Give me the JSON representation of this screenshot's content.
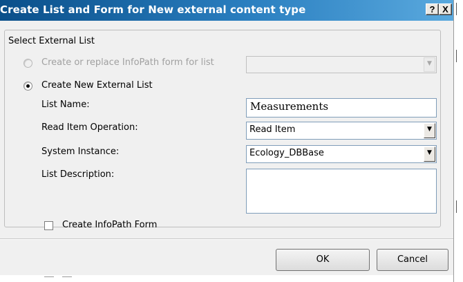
{
  "window": {
    "title": "Create List and Form for New external content type",
    "help_button": "?",
    "close_button": "X"
  },
  "group": {
    "legend": "Select External List"
  },
  "options": {
    "infopath_replace": {
      "label": "Create or replace InfoPath form for list",
      "selected": false,
      "enabled": false,
      "list_value": ""
    },
    "new_list": {
      "label": "Create New External List",
      "selected": true
    }
  },
  "fields": {
    "list_name": {
      "label": "List Name:",
      "value": "Measurements"
    },
    "read_item_operation": {
      "label": "Read Item Operation:",
      "value": "Read Item"
    },
    "system_instance": {
      "label": "System Instance:",
      "value": "Ecology_DBBase"
    },
    "list_description": {
      "label": "List Description:",
      "value": ""
    }
  },
  "create_infopath_form": {
    "label": "Create InfoPath Form",
    "checked": false
  },
  "buttons": {
    "ok": "OK",
    "cancel": "Cancel"
  },
  "icons": {
    "dropdown": "chevron-down-icon",
    "radio_selected": "radio-dot-icon"
  },
  "colors": {
    "titlebar_dark": "#0a4f8a",
    "titlebar_light": "#5aa9de",
    "dialog_bg": "#f0f0f0",
    "disabled_text": "#a0a0a0"
  }
}
